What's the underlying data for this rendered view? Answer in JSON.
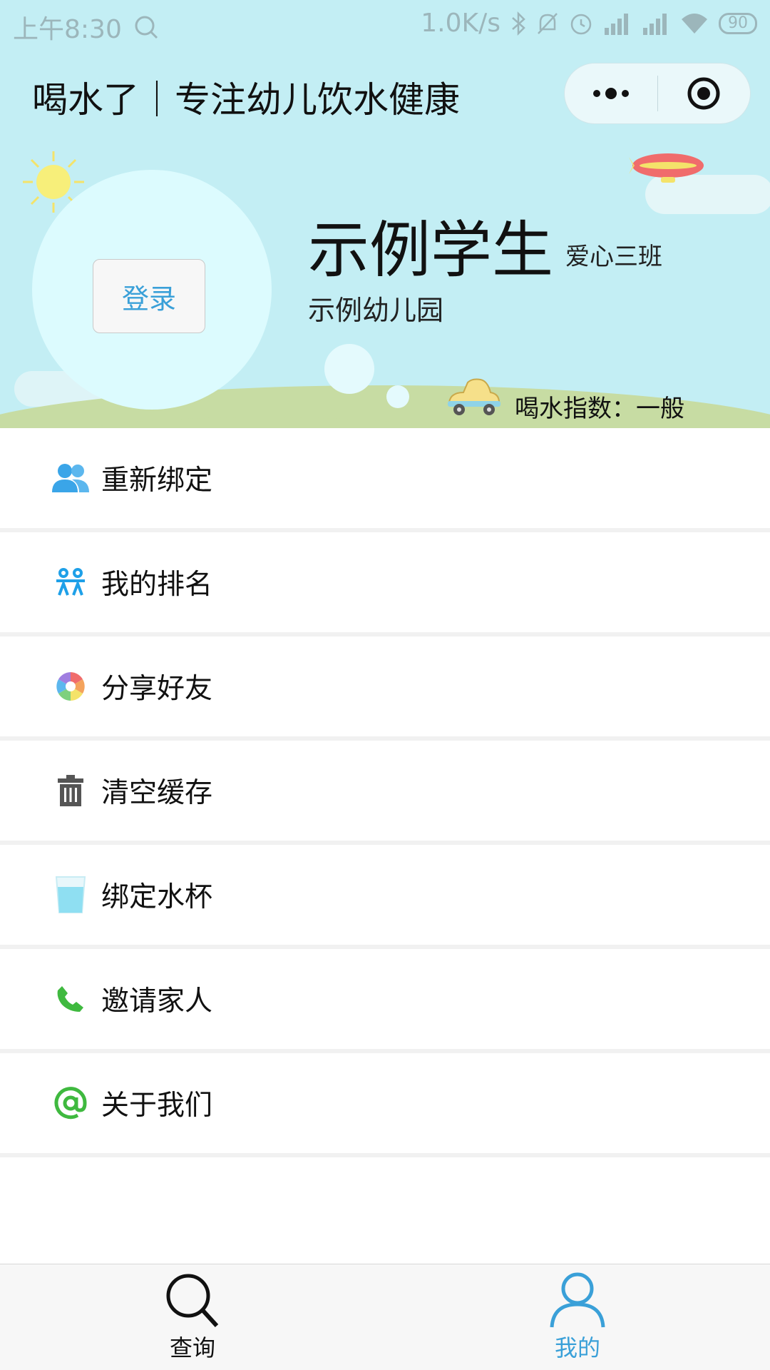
{
  "status_bar": {
    "time": "上午8:30",
    "speed": "1.0K/s",
    "battery": "90"
  },
  "nav": {
    "title": "喝水了｜专注幼儿饮水健康"
  },
  "profile": {
    "login_label": "登录",
    "student_name": "示例学生",
    "class_name": "爱心三班",
    "school_name": "示例幼儿园",
    "drink_index": "喝水指数：一般"
  },
  "menu": {
    "items": [
      {
        "label": "重新绑定",
        "icon": "users-icon",
        "color": "#3aa5e8"
      },
      {
        "label": "我的排名",
        "icon": "ranking-icon",
        "color": "#1ea0e8"
      },
      {
        "label": "分享好友",
        "icon": "share-aperture-icon",
        "color": "#e86a6a"
      },
      {
        "label": "清空缓存",
        "icon": "trash-icon",
        "color": "#555555"
      },
      {
        "label": "绑定水杯",
        "icon": "water-cup-icon",
        "color": "#8fdff2"
      },
      {
        "label": "邀请家人",
        "icon": "phone-icon",
        "color": "#3fb93f"
      },
      {
        "label": "关于我们",
        "icon": "at-icon",
        "color": "#3fb93f"
      }
    ]
  },
  "tabbar": {
    "query_label": "查询",
    "mine_label": "我的",
    "active_color": "#3aa0d8",
    "inactive_color": "#111111"
  },
  "colors": {
    "header_bg": "#c3eef4",
    "accent": "#3aa0d8"
  }
}
